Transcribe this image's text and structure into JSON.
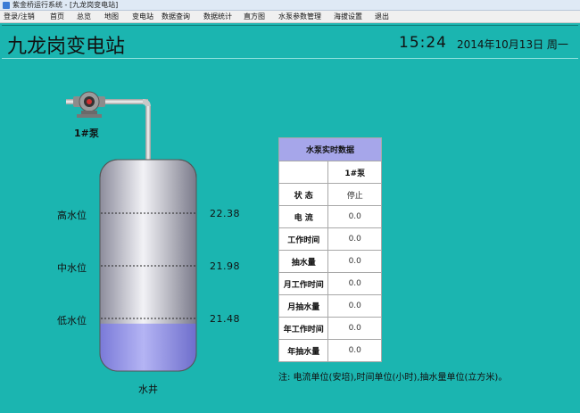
{
  "window": {
    "title": "紫金桥运行系统 - [九龙岗变电站]"
  },
  "menu": [
    {
      "label": "登录/注销"
    },
    {
      "label": "首页"
    },
    {
      "label": "总览"
    },
    {
      "label": "地图"
    },
    {
      "label": "变电站"
    },
    {
      "label": "数据查询"
    },
    {
      "label": "数据统计"
    },
    {
      "label": "直方图"
    },
    {
      "label": "水泵参数管理"
    },
    {
      "label": "海拔设置"
    },
    {
      "label": "退出"
    }
  ],
  "header": {
    "title": "九龙岗变电站",
    "time": "15:24",
    "date": "2014年10月13日 周一"
  },
  "pump": {
    "label": "1#泵",
    "icon": "pump-icon"
  },
  "well": {
    "label": "水井",
    "water_level_fraction": 0.14,
    "levels": [
      {
        "label": "高水位",
        "value": "22.38"
      },
      {
        "label": "中水位",
        "value": "21.98"
      },
      {
        "label": "低水位",
        "value": "21.48"
      }
    ]
  },
  "table": {
    "title": "水泵实时数据",
    "column": "1#泵",
    "rows": [
      {
        "label": "状  态",
        "value": "停止"
      },
      {
        "label": "电  流",
        "value": "0.0"
      },
      {
        "label": "工作时间",
        "value": "0.0"
      },
      {
        "label": "抽水量",
        "value": "0.0"
      },
      {
        "label": "月工作时间",
        "value": "0.0"
      },
      {
        "label": "月抽水量",
        "value": "0.0"
      },
      {
        "label": "年工作时间",
        "value": "0.0"
      },
      {
        "label": "年抽水量",
        "value": "0.0"
      }
    ]
  },
  "note": "注: 电流单位(安培),时间单位(小时),抽水量单位(立方米)。",
  "colors": {
    "background": "#1bb5b0",
    "table_header": "#a6a6ea",
    "water": "#8f8fe6"
  }
}
